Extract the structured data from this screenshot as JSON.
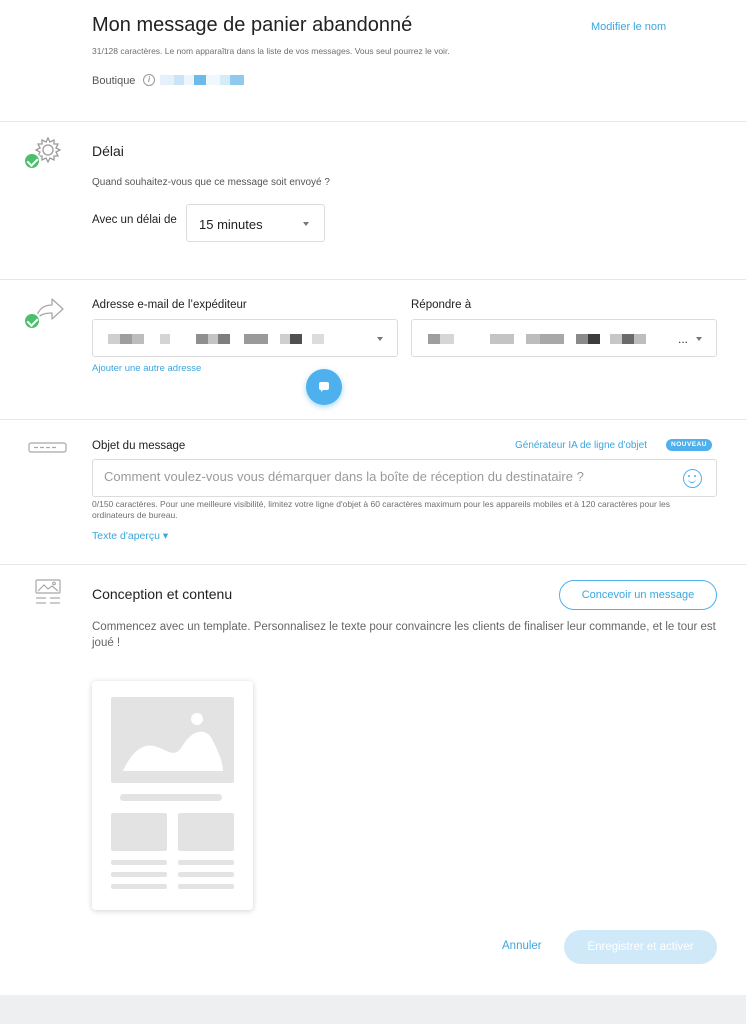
{
  "header": {
    "title": "Mon message de panier abandonné",
    "rename_label": "Modifier le nom",
    "hint": "31/128 caractères. Le nom apparaîtra dans la liste de vos messages. Vous seul pourrez le voir.",
    "shop_label": "Boutique",
    "info_icon": "i"
  },
  "delay": {
    "title": "Délai",
    "question": "Quand souhaitez-vous que ce message soit envoyé ?",
    "delay_label": "Avec un délai de",
    "delay_value": "15 minutes"
  },
  "sender": {
    "from_label": "Adresse e-mail de l’expéditeur",
    "reply_label": "Répondre à",
    "reply_suffix": "...",
    "add_address": "Ajouter une autre adresse"
  },
  "subject": {
    "label": "Objet du message",
    "ai_link": "Générateur IA de ligne d'objet",
    "badge": "NOUVEAU",
    "placeholder": "Comment voulez-vous vous démarquer dans la boîte de réception du destinataire ?",
    "count_note": "0/150 caractères. Pour une meilleure visibilité, limitez votre ligne d'objet à 60 caractères maximum pour les appareils mobiles et à 120 caractères pour les ordinateurs de bureau.",
    "preview_link": "Texte d'aperçu ▾"
  },
  "design": {
    "title": "Conception et contenu",
    "design_button": "Concevoir un message",
    "description": "Commencez avec un template. Personnalisez le texte pour convaincre les clients de finaliser leur commande, et le tour est joué !"
  },
  "footer": {
    "cancel": "Annuler",
    "save_activate": "Enregistrer et activer"
  },
  "colors": {
    "accent": "#3aa6e0",
    "check_green": "#4bbf6b",
    "save_disabled": "#cfe9f9"
  },
  "icons": [
    "info-icon",
    "gear-icon",
    "check-icon",
    "forward-arrow-icon",
    "chat-icon",
    "subject-line-icon",
    "emoji-icon",
    "template-icon"
  ]
}
